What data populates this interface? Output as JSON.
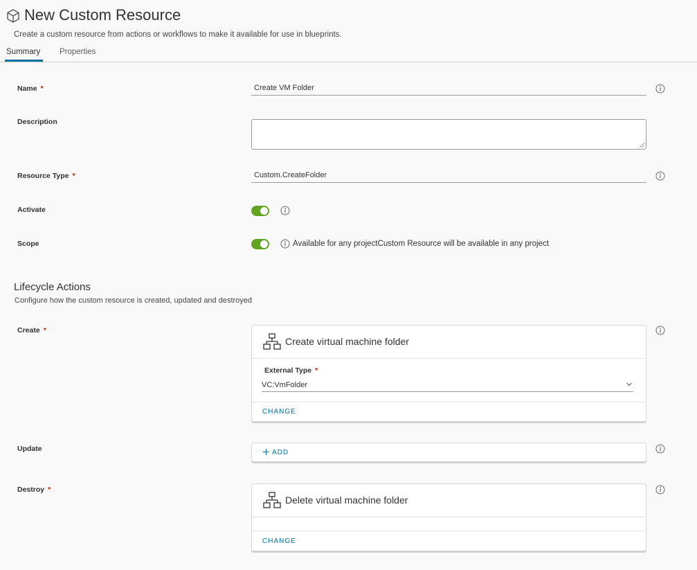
{
  "header": {
    "title": "New Custom Resource",
    "subtitle": "Create a custom resource from actions or workflows to make it available for use in blueprints."
  },
  "tabs": [
    {
      "label": "Summary",
      "active": true
    },
    {
      "label": "Properties",
      "active": false
    }
  ],
  "form": {
    "name": {
      "label": "Name",
      "required_mark": "*",
      "value": "Create VM Folder"
    },
    "description": {
      "label": "Description",
      "value": ""
    },
    "resource_type": {
      "label": "Resource Type",
      "required_mark": "*",
      "value": "Custom.CreateFolder"
    },
    "activate": {
      "label": "Activate",
      "on": true
    },
    "scope": {
      "label": "Scope",
      "on": true,
      "text": "Available for any projectCustom Resource will be available in any project"
    }
  },
  "lifecycle": {
    "title": "Lifecycle Actions",
    "subtitle": "Configure how the custom resource is created, updated and destroyed",
    "create": {
      "label": "Create",
      "required_mark": "*",
      "action_title": "Create virtual machine folder",
      "external_type_label": "External Type",
      "external_type_required": "*",
      "external_type_value": "VC:VmFolder",
      "change_label": "CHANGE"
    },
    "update": {
      "label": "Update",
      "add_label": "ADD"
    },
    "destroy": {
      "label": "Destroy",
      "required_mark": "*",
      "action_title": "Delete virtual machine folder",
      "change_label": "CHANGE"
    }
  },
  "colors": {
    "accent": "#0072a3",
    "toggle_on": "#62a420",
    "required": "#c21d00"
  },
  "icons": [
    "cube-icon",
    "info-icon",
    "workflow-icon",
    "chevron-down-icon",
    "plus-icon"
  ]
}
